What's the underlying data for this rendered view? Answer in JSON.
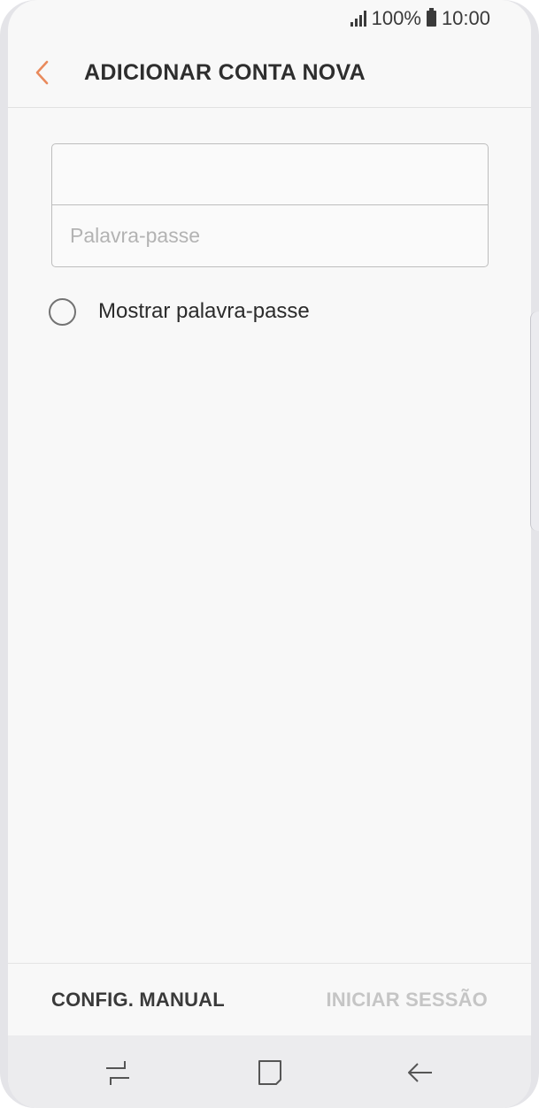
{
  "status_bar": {
    "battery_text": "100%",
    "time": "10:00",
    "icons": [
      "signal-icon",
      "battery-icon"
    ]
  },
  "header": {
    "back_icon": "chevron-left-icon",
    "title": "ADICIONAR CONTA NOVA"
  },
  "form": {
    "email": {
      "value": "",
      "placeholder": ""
    },
    "password": {
      "value": "",
      "placeholder": "Palavra-passe"
    },
    "show_password": {
      "label": "Mostrar palavra-passe",
      "checked": false
    }
  },
  "actions": {
    "manual_setup": "CONFIG. MANUAL",
    "sign_in": "INICIAR SESSÃO"
  },
  "nav": {
    "icons": [
      "recent-apps-icon",
      "home-icon",
      "back-arrow-icon"
    ]
  },
  "colors": {
    "accent": "#e98a5c",
    "background": "#f8f8f8",
    "disabled_text": "#c5c5c5"
  }
}
